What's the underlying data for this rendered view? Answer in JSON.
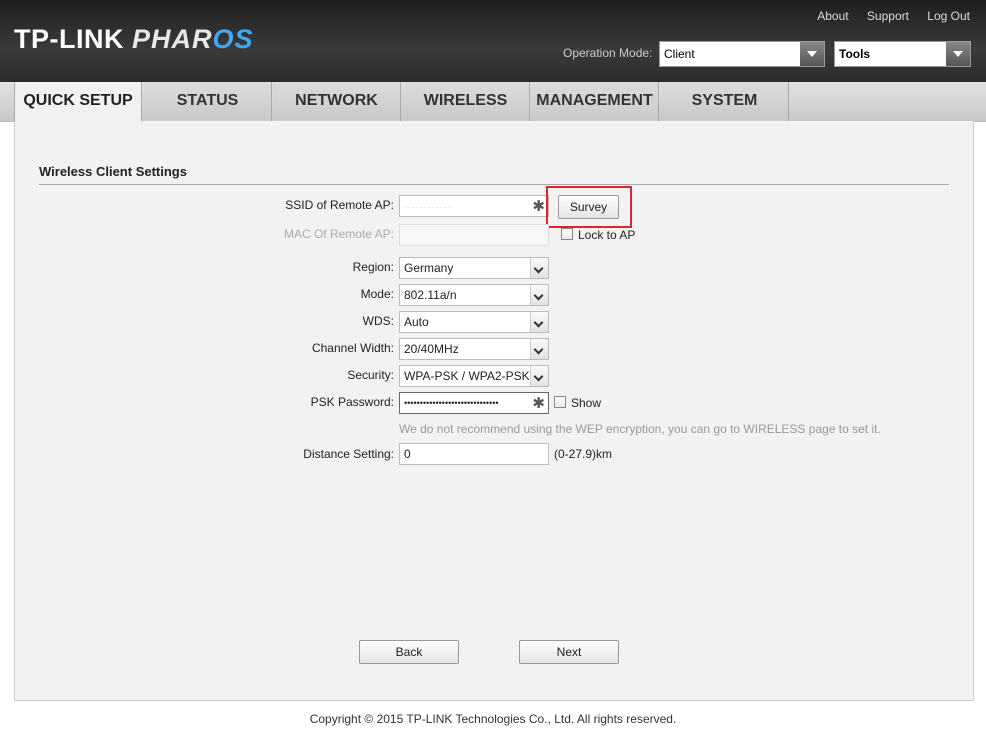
{
  "header": {
    "brand": "TP-LINK",
    "product_a": "PHAR",
    "product_b": "OS",
    "links": [
      "About",
      "Support",
      "Log Out"
    ],
    "operation_mode_label": "Operation Mode:",
    "operation_mode_value": "Client",
    "tools_value": "Tools"
  },
  "nav": {
    "tabs": [
      "QUICK SETUP",
      "STATUS",
      "NETWORK",
      "WIRELESS",
      "MANAGEMENT",
      "SYSTEM"
    ],
    "active": "QUICK SETUP"
  },
  "section": {
    "title": "Wireless Client Settings"
  },
  "form": {
    "ssid_label": "SSID of Remote AP:",
    "ssid_value": "············",
    "survey_button": "Survey",
    "mac_label": "MAC Of Remote AP:",
    "lock_label": "Lock to AP",
    "region_label": "Region:",
    "region_value": "Germany",
    "mode_label": "Mode:",
    "mode_value": "802.11a/n",
    "wds_label": "WDS:",
    "wds_value": "Auto",
    "channel_width_label": "Channel Width:",
    "channel_width_value": "20/40MHz",
    "security_label": "Security:",
    "security_value": "WPA-PSK / WPA2-PSK",
    "psk_label": "PSK Password:",
    "psk_value": "••••••••••••••••••••••••••••••",
    "show_label": "Show",
    "hint": "We do not recommend using the WEP encryption, you can go to WIRELESS page to set it.",
    "distance_label": "Distance Setting:",
    "distance_value": "0",
    "distance_unit": "(0-27.9)km"
  },
  "buttons": {
    "back": "Back",
    "next": "Next"
  },
  "footer": {
    "copyright": "Copyright © 2015 TP-LINK Technologies Co., Ltd. All rights reserved."
  },
  "colors": {
    "accent_blue": "#3fa9f5",
    "highlight_red": "#e0262d",
    "header_bg": "#2c2c2c"
  }
}
